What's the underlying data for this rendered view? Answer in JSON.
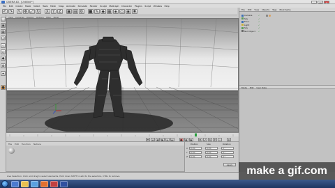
{
  "window": {
    "title": "CINEMA 4D - [Untitled *]"
  },
  "menubar": {
    "items": [
      "File",
      "Edit",
      "Create",
      "Mode",
      "Select",
      "Tools",
      "Mesh",
      "Snap",
      "Animate",
      "Simulate",
      "Render",
      "Sculpt",
      "MoGraph",
      "Character",
      "Plugins",
      "Script",
      "Window",
      "Help"
    ]
  },
  "viewport": {
    "menu": [
      "View",
      "Cameras",
      "Display",
      "Options",
      "Filter",
      "Panel"
    ]
  },
  "right_panel": {
    "tabs": [
      "File",
      "Edit",
      "View",
      "Objects",
      "Tags",
      "Bookmarks"
    ],
    "objects": [
      {
        "name": "Camera",
        "color": "#3d6fb5"
      },
      {
        "name": "Sky",
        "color": "#5a9a5a"
      },
      {
        "name": "Floor",
        "color": "#3d6fb5"
      },
      {
        "name": "Light",
        "color": "#c9b03a"
      },
      {
        "name": "Sky",
        "color": "#5a9a5a"
      },
      {
        "name": "Null Object",
        "color": "#6a6a6a"
      }
    ],
    "attr_tabs": [
      "Mode",
      "Edit",
      "User Data"
    ]
  },
  "material_manager": {
    "menu": [
      "File",
      "Edit",
      "Function",
      "Texture"
    ]
  },
  "coordinates": {
    "headers": [
      "Position",
      "Size",
      "Rotation"
    ],
    "rows": [
      {
        "axis": "X",
        "pos": "0 cm",
        "size": "0 cm",
        "rot": "0 °"
      },
      {
        "axis": "Y",
        "pos": "0 cm",
        "size": "0 cm",
        "rot": "0 °"
      },
      {
        "axis": "Z",
        "pos": "0 cm",
        "size": "0 cm",
        "rot": "0 °"
      }
    ],
    "apply_label": "Apply"
  },
  "status": {
    "text": "Live Selection: Click and drag to select elements. Hold down SHIFT to add to the selection, CTRL to remove."
  },
  "watermark": {
    "text": "make a gif.com"
  },
  "colors": {
    "accent": "#f0a020",
    "taskbar": "#2b4677"
  }
}
